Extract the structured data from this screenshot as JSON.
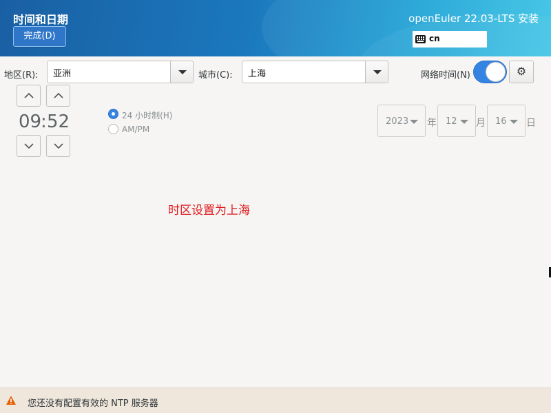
{
  "header": {
    "title": "时间和日期",
    "done_label": "完成(D)",
    "product": "openEuler 22.03-LTS 安装",
    "keyboard_layout": "cn"
  },
  "timezone": {
    "region_label": "地区(R):",
    "region_value": "亚洲",
    "city_label": "城市(C):",
    "city_value": "上海",
    "network_time_label": "网络时间(N)",
    "network_time_enabled": true
  },
  "time": {
    "hours": "09",
    "separator": ":",
    "minutes": "52",
    "format_24h_label": "24 小时制(H)",
    "format_ampm_label": "AM/PM",
    "selected_format": "24h"
  },
  "date": {
    "year": "2023",
    "year_unit": "年",
    "month": "12",
    "month_unit": "月",
    "day": "16",
    "day_unit": "日"
  },
  "annotation": "时区设置为上海",
  "status": {
    "message": "您还没有配置有效的 NTP 服务器",
    "icon": "warning-icon"
  },
  "colors": {
    "accent": "#3584e4",
    "annotation": "#e0171b",
    "warning": "#e66100"
  }
}
